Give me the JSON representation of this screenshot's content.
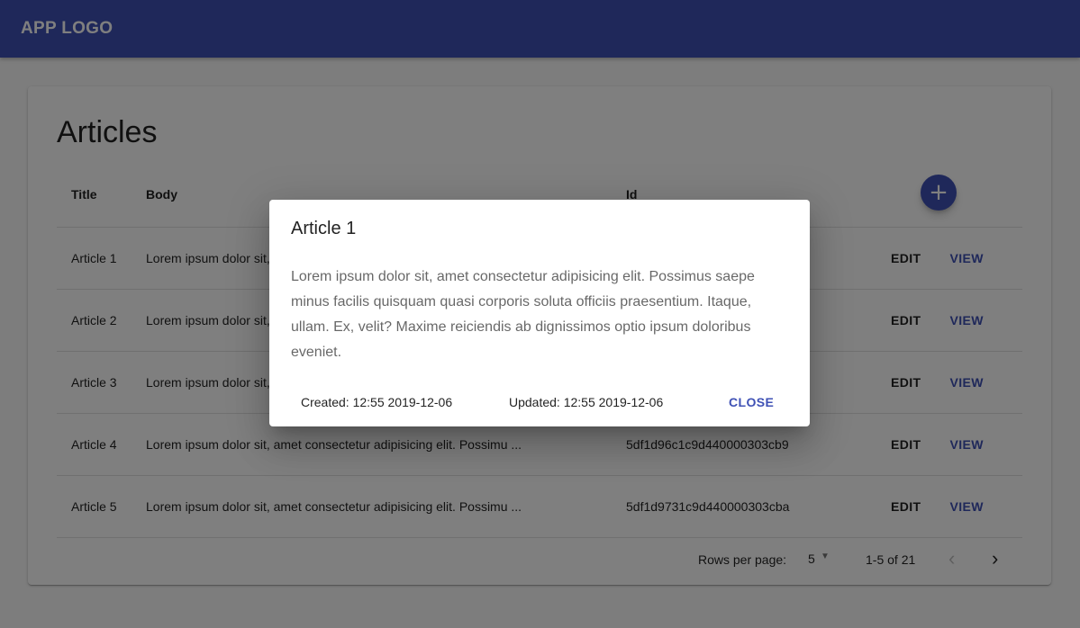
{
  "appbar": {
    "logo": "APP LOGO",
    "color": "#3f51b5"
  },
  "page": {
    "title": "Articles"
  },
  "table": {
    "headers": {
      "title": "Title",
      "body": "Body",
      "id": "Id"
    },
    "add_icon": "add-icon",
    "rows": [
      {
        "title": "Article 1",
        "body": "Lorem ipsum dolor sit, amet consectetur adipisicing elit. Possimu ...",
        "id": "",
        "edit": "EDIT",
        "view": "VIEW"
      },
      {
        "title": "Article 2",
        "body": "Lorem ipsum dolor sit, amet consectetur adipisicing elit. Possimu ...",
        "id": "",
        "edit": "EDIT",
        "view": "VIEW"
      },
      {
        "title": "Article 3",
        "body": "Lorem ipsum dolor sit, amet consectetur adipisicing elit. Possimu ...",
        "id": "",
        "edit": "EDIT",
        "view": "VIEW"
      },
      {
        "title": "Article 4",
        "body": "Lorem ipsum dolor sit, amet consectetur adipisicing elit. Possimu ...",
        "id": "5df1d96c1c9d440000303cb9",
        "edit": "EDIT",
        "view": "VIEW"
      },
      {
        "title": "Article 5",
        "body": "Lorem ipsum dolor sit, amet consectetur adipisicing elit. Possimu ...",
        "id": "5df1d9731c9d440000303cba",
        "edit": "EDIT",
        "view": "VIEW"
      }
    ]
  },
  "pagination": {
    "rows_per_page_label": "Rows per page:",
    "rows_per_page_value": "5",
    "range": "1-5 of 21",
    "prev_icon": "chevron-left-icon",
    "next_icon": "chevron-right-icon"
  },
  "dialog": {
    "title": "Article 1",
    "body": "Lorem ipsum dolor sit, amet consectetur adipisicing elit. Possimus saepe minus facilis quisquam quasi corporis soluta officiis praesentium. Itaque, ullam. Ex, velit? Maxime reiciendis ab dignissimos optio ipsum doloribus eveniet.",
    "created": "Created: 12:55 2019-12-06",
    "updated": "Updated: 12:55 2019-12-06",
    "close_label": "CLOSE"
  }
}
